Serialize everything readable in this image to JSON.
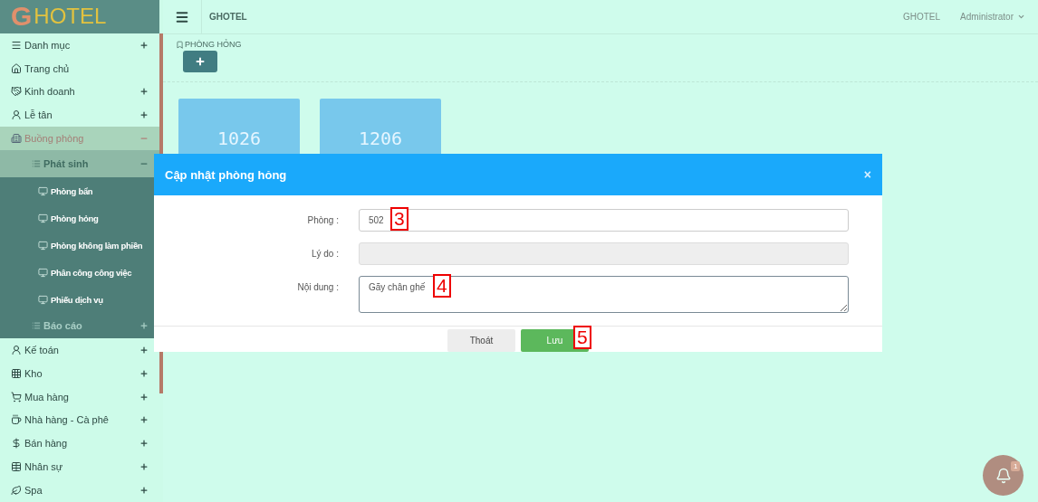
{
  "sidebar": {
    "logo_letter": "G",
    "logo_text": "HOTEL",
    "items": [
      {
        "label": "Danh mục",
        "expanded": false,
        "selected": false
      },
      {
        "label": "Trang chủ",
        "selected": false
      },
      {
        "label": "Kinh doanh",
        "expanded": false,
        "selected": false
      },
      {
        "label": "Lễ tân",
        "expanded": false,
        "selected": false
      },
      {
        "label": "Buồng phòng",
        "expanded": true,
        "selected": true,
        "children": [
          {
            "label": "Phát sinh",
            "expanded": true,
            "children": [
              {
                "label": "Phòng bẩn"
              },
              {
                "label": "Phòng hỏng"
              },
              {
                "label": "Phòng không làm phiền"
              },
              {
                "label": "Phân công công việc"
              },
              {
                "label": "Phiếu dịch vụ"
              }
            ]
          },
          {
            "label": "Báo cáo",
            "expanded": false
          }
        ]
      },
      {
        "label": "Kế toán",
        "expanded": false,
        "selected": false
      },
      {
        "label": "Kho",
        "expanded": false,
        "selected": false
      },
      {
        "label": "Mua hàng",
        "expanded": false,
        "selected": false
      },
      {
        "label": "Nhà hàng - Cà phê",
        "expanded": false,
        "selected": false
      },
      {
        "label": "Bán hàng",
        "expanded": false,
        "selected": false
      },
      {
        "label": "Nhân sự",
        "expanded": false,
        "selected": false
      },
      {
        "label": "Spa",
        "expanded": false,
        "selected": false
      }
    ]
  },
  "topbar": {
    "brand": "GHOTEL",
    "right_brand": "GHOTEL",
    "user": "Administrator"
  },
  "page": {
    "title": "PHÒNG HỎNG",
    "rooms": [
      "1026",
      "1206"
    ]
  },
  "modal": {
    "title": "Cập nhật phòng hỏng",
    "close": "×",
    "fields": [
      {
        "label": "Phòng :",
        "kind": "input",
        "value": "502",
        "disabled": false,
        "marker": "3"
      },
      {
        "label": "Lý do :",
        "kind": "input",
        "disabled": true
      },
      {
        "label": "Nội dung :",
        "kind": "textarea",
        "value": "Gãy chân ghế",
        "disabled": false,
        "marker": "4"
      }
    ],
    "buttons": [
      {
        "label": "Thoát",
        "kind": "cancel"
      },
      {
        "label": "Lưu",
        "kind": "save",
        "marker": "5"
      }
    ]
  },
  "notification": {
    "count": "1"
  }
}
